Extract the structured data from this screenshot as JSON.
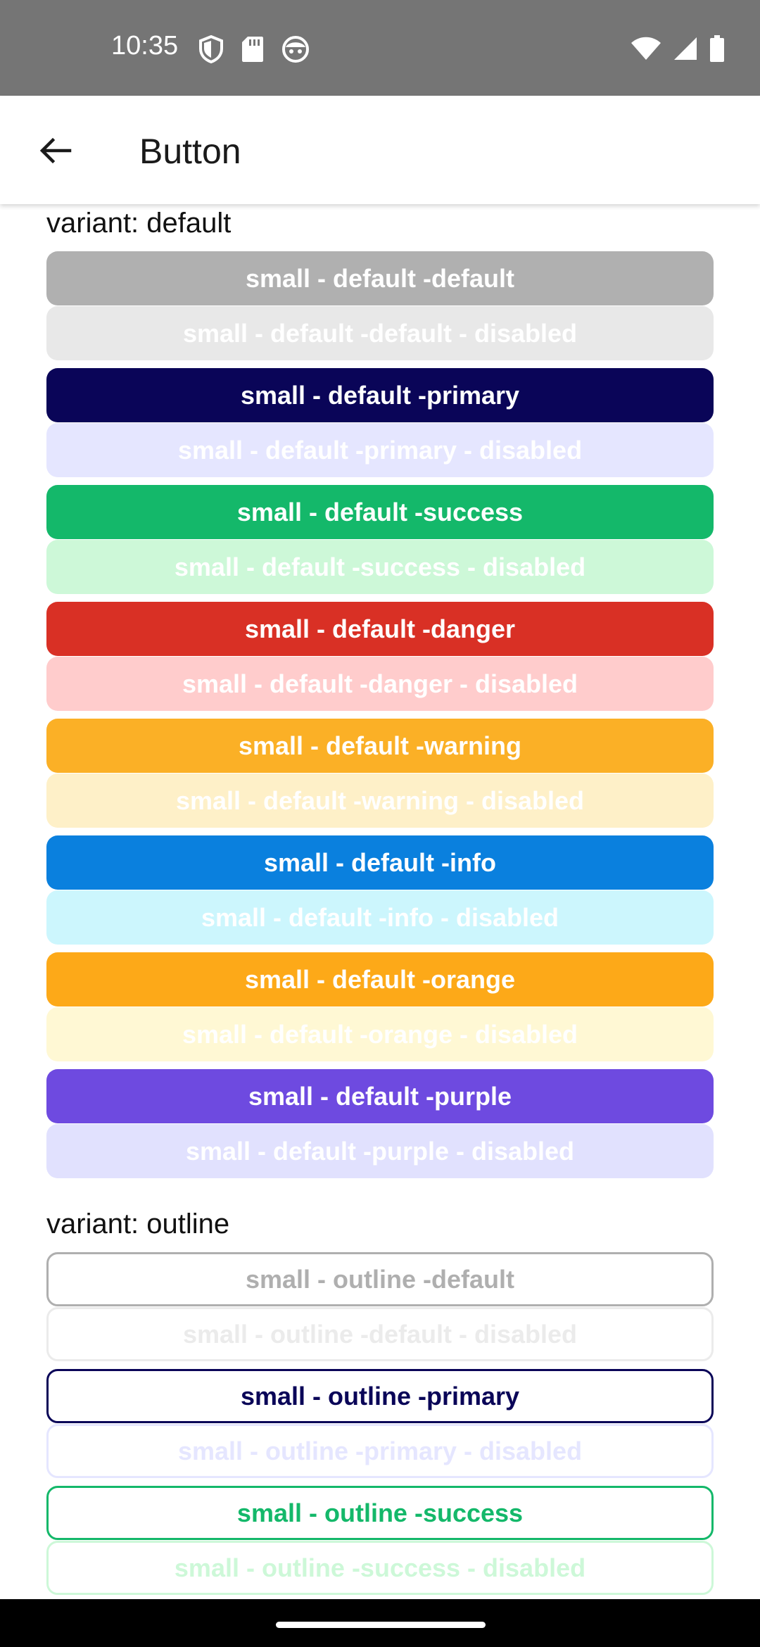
{
  "status_bar": {
    "time": "10:35",
    "left_icons": [
      "shield-icon",
      "sd-card-icon",
      "face-icon"
    ],
    "right_icons": [
      "wifi-icon",
      "signal-icon",
      "battery-icon"
    ]
  },
  "app_bar": {
    "back_icon": "arrow-back-icon",
    "title": "Button"
  },
  "sections": {
    "default": {
      "label": "variant: default"
    },
    "outline": {
      "label": "variant: outline"
    }
  },
  "buttons_default": [
    {
      "label": "small - default -default",
      "bg": "#B0B0B0",
      "color": "#FFFFFF",
      "disabled": false
    },
    {
      "label": "small - default -default - disabled",
      "bg": "#E8E8E8",
      "color": "#FFFFFF",
      "disabled": true
    },
    {
      "label": "small - default -primary",
      "bg": "#0A0558",
      "color": "#FFFFFF",
      "disabled": false
    },
    {
      "label": "small - default -primary - disabled",
      "bg": "#E5E6FF",
      "color": "#FFFFFF",
      "disabled": true
    },
    {
      "label": "small - default -success",
      "bg": "#14B86A",
      "color": "#FFFFFF",
      "disabled": false
    },
    {
      "label": "small - default -success - disabled",
      "bg": "#CDF8D8",
      "color": "#FFFFFF",
      "disabled": true
    },
    {
      "label": "small - default -danger",
      "bg": "#D93025",
      "color": "#FFFFFF",
      "disabled": false
    },
    {
      "label": "small - default -danger - disabled",
      "bg": "#FFCCCC",
      "color": "#FFFFFF",
      "disabled": true
    },
    {
      "label": "small - default -warning",
      "bg": "#FBB026",
      "color": "#FFFFFF",
      "disabled": false
    },
    {
      "label": "small - default -warning - disabled",
      "bg": "#FEF0C8",
      "color": "#FFFFFF",
      "disabled": true
    },
    {
      "label": "small - default -info",
      "bg": "#0A80DE",
      "color": "#FFFFFF",
      "disabled": false
    },
    {
      "label": "small - default -info - disabled",
      "bg": "#CCF6FD",
      "color": "#FFFFFF",
      "disabled": true
    },
    {
      "label": "small - default -orange",
      "bg": "#FDA918",
      "color": "#FFFFFF",
      "disabled": false
    },
    {
      "label": "small - default -orange - disabled",
      "bg": "#FFF8D4",
      "color": "#FFFFFF",
      "disabled": true
    },
    {
      "label": "small - default -purple",
      "bg": "#6E4AE0",
      "color": "#FFFFFF",
      "disabled": false
    },
    {
      "label": "small - default -purple - disabled",
      "bg": "#E1E1FE",
      "color": "#FFFFFF",
      "disabled": true
    }
  ],
  "buttons_outline": [
    {
      "label": "small - outline -default",
      "border": "#AFAFAF",
      "color": "#AFAFAF",
      "disabled": false
    },
    {
      "label": "small - outline -default - disabled",
      "border": "#EBEBEB",
      "color": "#EBEBEB",
      "disabled": true
    },
    {
      "label": "small - outline -primary",
      "border": "#0A0558",
      "color": "#0A0558",
      "disabled": false
    },
    {
      "label": "small - outline -primary - disabled",
      "border": "#E5E6FF",
      "color": "#E5E6FF",
      "disabled": true
    },
    {
      "label": "small - outline -success",
      "border": "#14B86A",
      "color": "#14B86A",
      "disabled": false
    },
    {
      "label": "small - outline -success - disabled",
      "border": "#CDF8D8",
      "color": "#CDF8D8",
      "disabled": true
    }
  ]
}
